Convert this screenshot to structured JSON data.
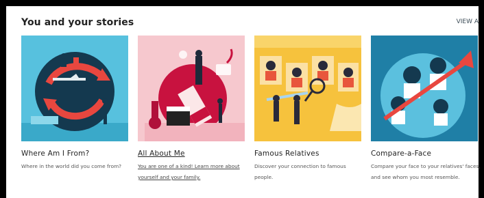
{
  "section": {
    "title": "You and your stories",
    "view_all": "VIEW A"
  },
  "cards": [
    {
      "title": "Where Am I From?",
      "description": "Where in the world did you come from?",
      "image_icon": "globe-travel-illustration"
    },
    {
      "title": "All About Me",
      "description": "You are one of a kind! Learn more about yourself and your family.",
      "image_icon": "all-about-me-illustration"
    },
    {
      "title": "Famous Relatives",
      "description": "Discover your connection to famous people.",
      "image_icon": "famous-relatives-illustration"
    },
    {
      "title": "Compare-a-Face",
      "description": "Compare your face to your relatives' faces, and see whom you most resemble.",
      "image_icon": "compare-a-face-illustration"
    }
  ],
  "colors": {
    "card1_bg": "#57c1de",
    "card2_bg": "#f6c8ce",
    "card3_bg": "#f6c23d",
    "card4_bg": "#1f7fa6"
  }
}
